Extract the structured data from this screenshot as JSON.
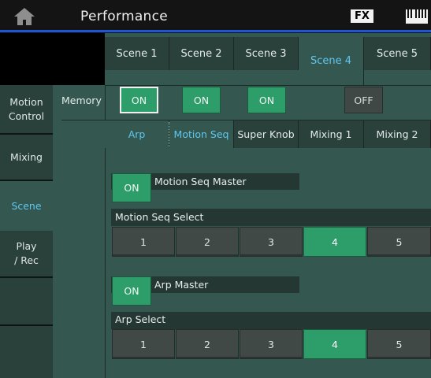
{
  "header": {
    "title": "Performance",
    "fx_label": "FX",
    "home_icon": "home-icon",
    "keyboard_icon": "keyboard-icon"
  },
  "sidebar": {
    "items": [
      {
        "label": "Motion\nControl",
        "active": false
      },
      {
        "label": "Mixing",
        "active": false
      },
      {
        "label": "Scene",
        "active": true
      },
      {
        "label": "Play\n/ Rec",
        "active": false
      }
    ]
  },
  "scenes": {
    "tabs": [
      "Scene 1",
      "Scene 2",
      "Scene 3",
      "Scene 4",
      "Scene 5"
    ],
    "selected": "Scene 4"
  },
  "memory": {
    "label": "Memory",
    "buttons": [
      "ON",
      "ON",
      "ON",
      "OFF"
    ]
  },
  "subtabs": {
    "items": [
      "Arp",
      "Motion Seq",
      "Super Knob",
      "Mixing 1",
      "Mixing 2"
    ],
    "selected": "Motion Seq"
  },
  "motion_seq": {
    "master_on": "ON",
    "master_label": "Motion Seq Master",
    "select_label": "Motion Seq Select",
    "options": [
      "1",
      "2",
      "3",
      "4",
      "5"
    ],
    "selected": "4"
  },
  "arp": {
    "master_on": "ON",
    "master_label": "Arp Master",
    "select_label": "Arp Select",
    "options": [
      "1",
      "2",
      "3",
      "4",
      "5"
    ],
    "selected": "4"
  },
  "colors": {
    "accent_blue": "#5fc6f2",
    "on_green": "#2d9e6a",
    "panel": "#34574f",
    "tab": "#2a403b",
    "header_line": "#1f56d6"
  }
}
